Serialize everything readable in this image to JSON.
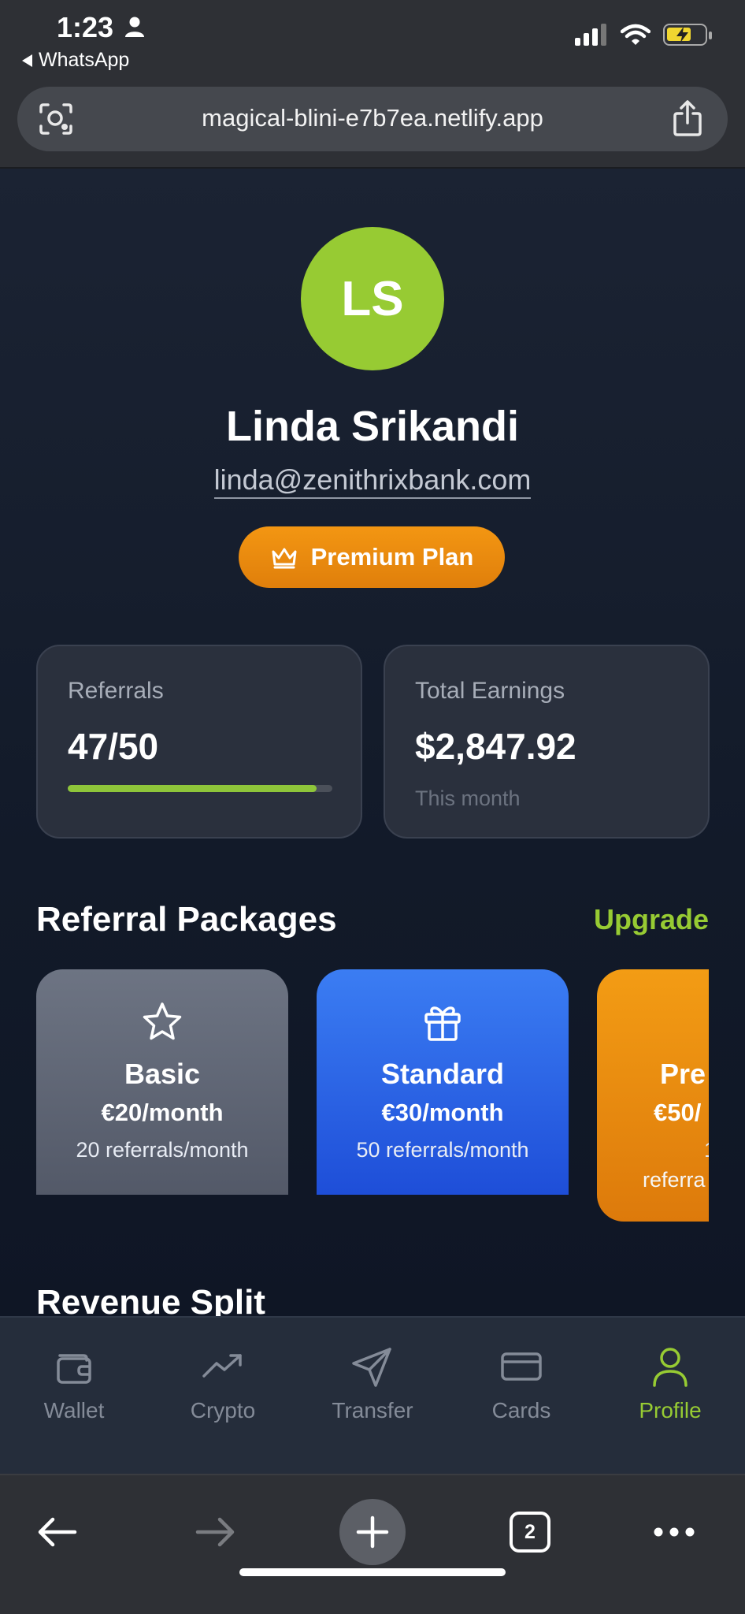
{
  "status_bar": {
    "time": "1:23",
    "back_app": "WhatsApp"
  },
  "browser": {
    "url": "magical-blini-e7b7ea.netlify.app",
    "tab_count": "2"
  },
  "profile": {
    "initials": "LS",
    "name": "Linda Srikandi",
    "email": "linda@zenithrixbank.com",
    "plan_badge": "Premium Plan"
  },
  "stats": {
    "referrals": {
      "label": "Referrals",
      "value": "47/50",
      "progress": 0.94
    },
    "earnings": {
      "label": "Total Earnings",
      "value": "$2,847.92",
      "sub": "This month"
    }
  },
  "referral_packages": {
    "title": "Referral Packages",
    "action": "Upgrade",
    "items": [
      {
        "name": "Basic",
        "price": "€20/month",
        "desc": "20 referrals/month",
        "icon": "star-icon"
      },
      {
        "name": "Standard",
        "price": "€30/month",
        "desc": "50 referrals/month",
        "icon": "gift-icon"
      },
      {
        "name": "Pre",
        "price": "€50/",
        "desc": "1",
        "desc2": "referra",
        "icon": "crown-icon"
      }
    ]
  },
  "revenue_split": {
    "title": "Revenue Split"
  },
  "app_nav": {
    "items": [
      {
        "label": "Wallet",
        "icon": "wallet-icon"
      },
      {
        "label": "Crypto",
        "icon": "trend-icon"
      },
      {
        "label": "Transfer",
        "icon": "send-icon"
      },
      {
        "label": "Cards",
        "icon": "card-icon"
      },
      {
        "label": "Profile",
        "icon": "user-icon",
        "active": true
      }
    ]
  },
  "colors": {
    "accent_green": "#97cb33",
    "premium_orange": "#f39612",
    "standard_blue": "#2f6ae6"
  }
}
